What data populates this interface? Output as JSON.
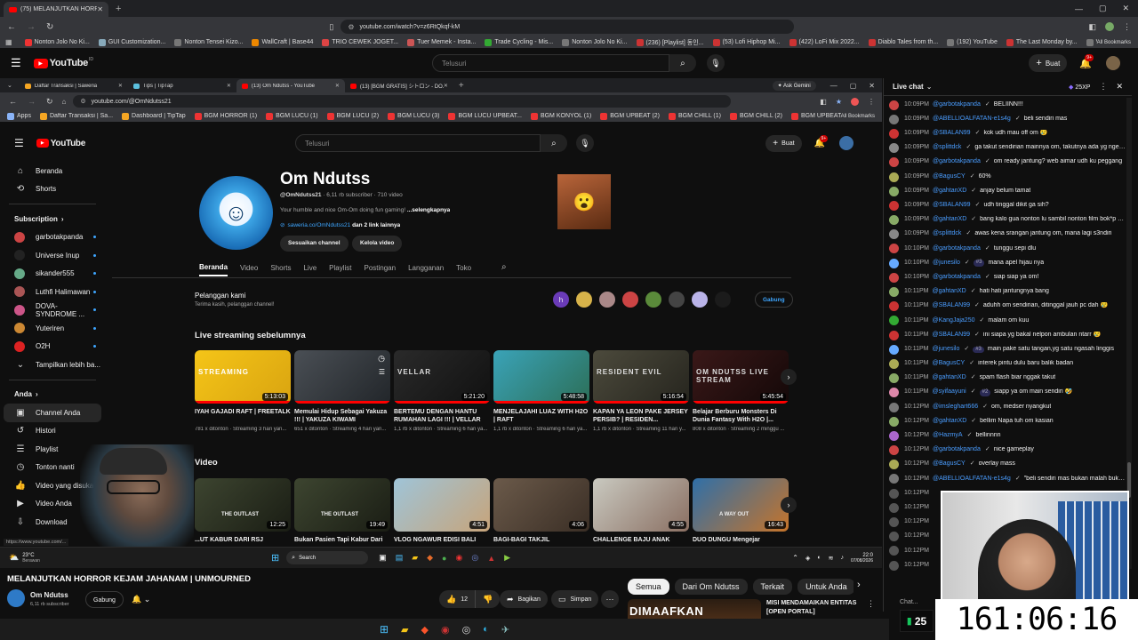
{
  "outer_browser": {
    "tab_title": "(75) MELANJUTKAN HORROR",
    "url": "youtube.com/watch?v=z6RtQkqf-kM",
    "bookmarks": [
      "Nonton Jolo No Ki...",
      "GUI Customization...",
      "Nonton Tensei Kizo...",
      "WallCraft | Base44",
      "TRIO CEWEK JOGET...",
      "Tuer Memek - Insta...",
      "Trade Cycling - Mis...",
      "Nonton Jolo No Ki...",
      "(236) [Playlist] 동인...",
      "(53) Lofi Hiphop Mi...",
      "(422) LoFi Mix 2022...",
      "Diablo Tales from th...",
      "(192) YouTube",
      "The Last Monday by...",
      "Voucher Game dan..."
    ],
    "all_bookmarks": "All Bookmarks"
  },
  "outer_youtube": {
    "logo": "YouTube",
    "logo_sup": "ID",
    "search_placeholder": "Telusuri",
    "create_label": "Buat",
    "notif_count": "9+"
  },
  "inner_browser": {
    "tabs": [
      "Daftar Transaksi | Saweria",
      "Tips | TipTap",
      "(13) Om Ndutss - YouTube",
      "(13) [BGM GRATIS] シトロン - DO..."
    ],
    "ask_gemini": "Ask Gemini",
    "url": "youtube.com/@OmNdutss21",
    "bookmarks": [
      "Apps",
      "Daftar Transaksi | Sa...",
      "Dashboard | TipTap",
      "BGM HORROR (1)",
      "BGM LUCU (1)",
      "BGM LUCU (2)",
      "BGM LUCU (3)",
      "BGM LUCU UPBEAT...",
      "BGM KONYOL (1)",
      "BGM UPBEAT (2)",
      "BGM CHILL (1)",
      "BGM CHILL (2)",
      "BGM UPBEAT (3)"
    ],
    "all_bookmarks": "All Bookmarks",
    "status_url": "https://www.youtube.com/..."
  },
  "inner_youtube": {
    "search_placeholder": "Telusuri",
    "create_label": "Buat",
    "notif_count": "9+"
  },
  "sidebar": {
    "home": "Beranda",
    "shorts": "Shorts",
    "subscription_heading": "Subscription",
    "subs": [
      {
        "name": "garbotakpanda",
        "color": "#c44"
      },
      {
        "name": "Universe Inup",
        "color": "#222"
      },
      {
        "name": "sikander555",
        "color": "#6a8"
      },
      {
        "name": "Luthfi Halimawan",
        "color": "#a55"
      },
      {
        "name": "DOVA-SYNDROME ...",
        "color": "#c58"
      },
      {
        "name": "Yuteriren",
        "color": "#c83"
      },
      {
        "name": "O2H",
        "color": "#d22"
      }
    ],
    "more": "Tampilkan lebih ba...",
    "you_heading": "Anda",
    "you_items": [
      "Channel Anda",
      "Histori",
      "Playlist",
      "Tonton nanti",
      "Video yang disukai",
      "Video Anda",
      "Download"
    ]
  },
  "channel": {
    "name": "Om Ndutss",
    "handle": "@OmNdutss21",
    "subs": "6,11 rb subscriber",
    "videos": "710 video",
    "desc": "Your humble and nice Om-Om doing fun gaming!",
    "more": "...selengkapnya",
    "link": "saweria.co/OmNdutss21",
    "link_more": "dan 2 link lainnya",
    "btn_customize": "Sesuaikan channel",
    "btn_manage": "Kelola video",
    "tabs": [
      "Beranda",
      "Video",
      "Shorts",
      "Live",
      "Playlist",
      "Postingan",
      "Langganan",
      "Toko"
    ],
    "members_title": "Pelanggan kami",
    "members_sub": "Terima kasih, pelanggan channel!",
    "join": "Gabung",
    "member_initial": "h"
  },
  "live_section": {
    "title": "Live streaming sebelumnya",
    "items": [
      {
        "title": "IYAH GAJADI RAFT | FREETALK",
        "meta": "781 x ditonton · Streaming 3 hari yan...",
        "dur": "5:13:03",
        "c1": "#f5c518",
        "c2": "#d9a410"
      },
      {
        "title": "Memulai Hidup Sebagai Yakuza !!! | YAKUZA KIWAMI",
        "meta": "651 x ditonton · Streaming 4 hari yan...",
        "dur": "",
        "c1": "#4a4f55",
        "c2": "#22262a"
      },
      {
        "title": "BERTEMU DENGAN HANTU RUMAHAN LAGI !!! | VELLAR",
        "meta": "1,1 rb x ditonton · Streaming 6 hari ya...",
        "dur": "5:21:20",
        "c1": "#2a2a2a",
        "c2": "#111"
      },
      {
        "title": "MENJELAJAHI LUAZ WITH H2O | RAFT",
        "meta": "1,1 rb x ditonton · Streaming 6 hari ya...",
        "dur": "5:48:58",
        "c1": "#3aa3b8",
        "c2": "#2c6f58"
      },
      {
        "title": "KAPAN YA LEON PAKE JERSEY PERSIB? | RESIDEN...",
        "meta": "1,1 rb x ditonton · Streaming 11 hari y...",
        "dur": "5:16:54",
        "c1": "#4c4a3c",
        "c2": "#26251e"
      },
      {
        "title": "Belajar Berburu Monsters Di Dunia Fantasy With H2O |...",
        "meta": "808 x ditonton · Streaming 2 minggu ...",
        "dur": "5:45:54",
        "c1": "#3a1818",
        "c2": "#140808"
      }
    ],
    "thumb_texts": [
      "STREAMING",
      "",
      "VELLAR",
      "",
      "RESIDENT EVIL",
      "OM NDUTSS LIVE STREAM"
    ]
  },
  "video_section": {
    "title": "Video",
    "items": [
      {
        "title": "...UT KABUR DARI RSJ",
        "dur": "12:25",
        "c1": "#3d4530",
        "c2": "#1a1d14",
        "txt": "THE OUTLAST"
      },
      {
        "title": "Bukan Pasien Tapi Kabur Dari",
        "dur": "19:49",
        "c1": "#3d4530",
        "c2": "#1a1d14",
        "txt": "THE OUTLAST"
      },
      {
        "title": "VLOG NGAWUR EDISI BALI",
        "dur": "4:51",
        "c1": "#9fc4d8",
        "c2": "#c7a47a",
        "txt": ""
      },
      {
        "title": "BAGI-BAGI TAKJIL",
        "dur": "4:06",
        "c1": "#6b5a4a",
        "c2": "#3a2e25",
        "txt": ""
      },
      {
        "title": "CHALLENGE BAJU ANAK",
        "dur": "4:55",
        "c1": "#c9c9c0",
        "c2": "#8a6f62",
        "txt": ""
      },
      {
        "title": "DUO DUNGU Mengejar",
        "dur": "16:43",
        "c1": "#2f6fa8",
        "c2": "#c6742a",
        "txt": "A WAY OUT"
      }
    ]
  },
  "inner_taskbar": {
    "weather_temp": "23°C",
    "weather_desc": "Berawan",
    "search": "Search",
    "time": "22:0",
    "date": "07/08/2026"
  },
  "watch": {
    "title": "MELANJUTKAN HORROR KEJAM JAHANAM | UNMOURNED",
    "channel": "Om Ndutss",
    "subs": "6,11 rb subscriber",
    "join": "Gabung",
    "likes": "12",
    "share": "Bagikan",
    "save": "Simpan",
    "chips": [
      "Semua",
      "Dari Om Ndutss",
      "Terkait",
      "Untuk Anda",
      "Live",
      "Baru di"
    ],
    "rec_title": "MISI MENDAMAIKAN ENTITAS [OPEN PORTAL]",
    "rec_thumb_text": "DIMAAFKAN"
  },
  "chat": {
    "header": "Live chat",
    "xp": "25XP",
    "footer_label": "Chat...",
    "messages": [
      {
        "time": "10:09PM",
        "name": "@garbotakpanda",
        "badge": "",
        "text": "BELIINN!!!",
        "color": "#c44"
      },
      {
        "time": "10:09PM",
        "name": "@ABELLIOALFATAN-e1s4g",
        "badge": "",
        "text": "beli sendiri mas",
        "color": "#777"
      },
      {
        "time": "10:09PM",
        "name": "@SBALAN99",
        "badge": "",
        "text": "kok udh mau off om 😢",
        "color": "#c33"
      },
      {
        "time": "10:09PM",
        "name": "@splittdck",
        "badge": "",
        "text": "ga takut sendirian mainnya om, takutnya ada yg ngerawel !!! om Awas!",
        "color": "#888"
      },
      {
        "time": "10:09PM",
        "name": "@garbotakpanda",
        "badge": "",
        "text": "om ready jantung? web aimar udh ku peggang",
        "color": "#c44"
      },
      {
        "time": "10:09PM",
        "name": "@BagusCY",
        "badge": "",
        "text": "60%",
        "color": "#aa5"
      },
      {
        "time": "10:09PM",
        "name": "@gahtanXD",
        "badge": "",
        "text": "anjay belum tamat",
        "color": "#8a6"
      },
      {
        "time": "10:09PM",
        "name": "@SBALAN99",
        "badge": "",
        "text": "udh tinggal dikit ga sih?",
        "color": "#c33"
      },
      {
        "time": "10:09PM",
        "name": "@gahtanXD",
        "badge": "",
        "text": "bang kalo gua nonton lu sambil nonton film bok*p boleh nggak",
        "color": "#8a6"
      },
      {
        "time": "10:09PM",
        "name": "@splittdck",
        "badge": "",
        "text": "awas kena srangan jantung om, mana lagi s3ndiri",
        "color": "#888"
      },
      {
        "time": "10:10PM",
        "name": "@garbotakpanda",
        "badge": "",
        "text": "tunggu sepi dlu",
        "color": "#c44"
      },
      {
        "time": "10:10PM",
        "name": "@junesilo",
        "badge": "#3",
        "text": "mana apel hijau nya",
        "color": "#6af"
      },
      {
        "time": "10:10PM",
        "name": "@garbotakpanda",
        "badge": "",
        "text": "siap siap ya om!",
        "color": "#c44"
      },
      {
        "time": "10:11PM",
        "name": "@gahtanXD",
        "badge": "",
        "text": "hati hati jantungnya bang",
        "color": "#8a6"
      },
      {
        "time": "10:11PM",
        "name": "@SBALAN99",
        "badge": "",
        "text": "aduhh om sendirian, ditinggal jauh pc dah 😢",
        "color": "#c33"
      },
      {
        "time": "10:11PM",
        "name": "@KangJaja250",
        "badge": "",
        "text": "malam om kuu",
        "color": "#3a3"
      },
      {
        "time": "10:11PM",
        "name": "@SBALAN99",
        "badge": "",
        "text": "ini siapa yg bakal nelpon ambulan ntarr 😢",
        "color": "#c33"
      },
      {
        "time": "10:11PM",
        "name": "@junesilo",
        "badge": "#3",
        "text": "main pake satu tangan,yg satu ngasah linggis",
        "color": "#6af"
      },
      {
        "time": "10:11PM",
        "name": "@BagusCY",
        "badge": "",
        "text": "interek pintu dulu baru balik badan",
        "color": "#aa5"
      },
      {
        "time": "10:11PM",
        "name": "@gahtanXD",
        "badge": "",
        "text": "spam flash biar nggak takut",
        "color": "#8a6"
      },
      {
        "time": "10:11PM",
        "name": "@syifaayuni",
        "badge": "#2",
        "text": "siapp ya om main sendiri 🤣",
        "color": "#d8a"
      },
      {
        "time": "10:12PM",
        "name": "@imsleghart666",
        "badge": "",
        "text": "om, medser nyangkut",
        "color": "#777"
      },
      {
        "time": "10:12PM",
        "name": "@gahtanXD",
        "badge": "",
        "text": "bellim Napa tuh om kasian",
        "color": "#8a6"
      },
      {
        "time": "10:12PM",
        "name": "@HazmyA",
        "badge": "",
        "text": "bellinnnn",
        "color": "#a6c"
      },
      {
        "time": "10:12PM",
        "name": "@garbotakpanda",
        "badge": "",
        "text": "nice gameplay",
        "color": "#c44"
      },
      {
        "time": "10:12PM",
        "name": "@BagusCY",
        "badge": "",
        "text": "overlay mass",
        "color": "#aa5"
      },
      {
        "time": "10:12PM",
        "name": "@ABELLIOALFATAN-e1s4g",
        "badge": "",
        "text": "\"beli sendiri mas bukan malah buka celana\"",
        "color": "#777"
      },
      {
        "time": "10:12PM",
        "name": "",
        "badge": "",
        "text": "",
        "color": "#555"
      },
      {
        "time": "10:12PM",
        "name": "",
        "badge": "",
        "text": "",
        "color": "#555"
      },
      {
        "time": "10:12PM",
        "name": "",
        "badge": "",
        "text": "",
        "color": "#555"
      },
      {
        "time": "10:12PM",
        "name": "",
        "badge": "",
        "text": "",
        "color": "#555"
      },
      {
        "time": "10:12PM",
        "name": "",
        "badge": "",
        "text": "",
        "color": "#555"
      },
      {
        "time": "10:12PM",
        "name": "",
        "badge": "",
        "text": "",
        "color": "#555"
      }
    ]
  },
  "overlay": {
    "timer": "161:06:16",
    "counter": "25"
  }
}
